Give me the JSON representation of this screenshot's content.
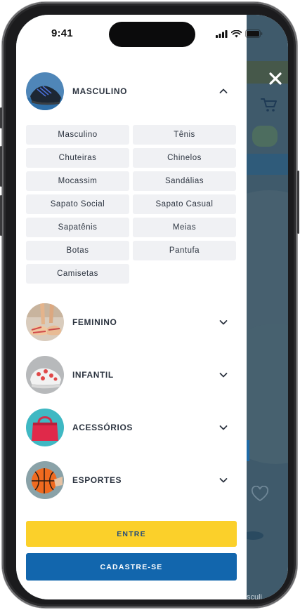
{
  "status_bar": {
    "time": "9:41"
  },
  "background": {
    "partial_text": "sculi"
  },
  "menu": {
    "categories": [
      {
        "label": "MASCULINO",
        "expanded": true,
        "icon": "chevron-up-icon"
      },
      {
        "label": "FEMININO",
        "expanded": false,
        "icon": "chevron-down-icon"
      },
      {
        "label": "INFANTIL",
        "expanded": false,
        "icon": "chevron-down-icon"
      },
      {
        "label": "ACESSÓRIOS",
        "expanded": false,
        "icon": "chevron-down-icon"
      },
      {
        "label": "ESPORTES",
        "expanded": false,
        "icon": "chevron-down-icon"
      }
    ],
    "masculino_items": [
      "Masculino",
      "Tênis",
      "Chuteiras",
      "Chinelos",
      "Mocassim",
      "Sandálias",
      "Sapato Social",
      "Sapato Casual",
      "Sapatênis",
      "Meias",
      "Botas",
      "Pantufa",
      "Camisetas"
    ]
  },
  "buttons": {
    "login": "ENTRE",
    "signup": "CADASTRE-SE"
  },
  "colors": {
    "login_bg": "#fbd02a",
    "signup_bg": "#1266ad",
    "text": "#2c3440",
    "submenu_bg": "#f0f1f4"
  }
}
